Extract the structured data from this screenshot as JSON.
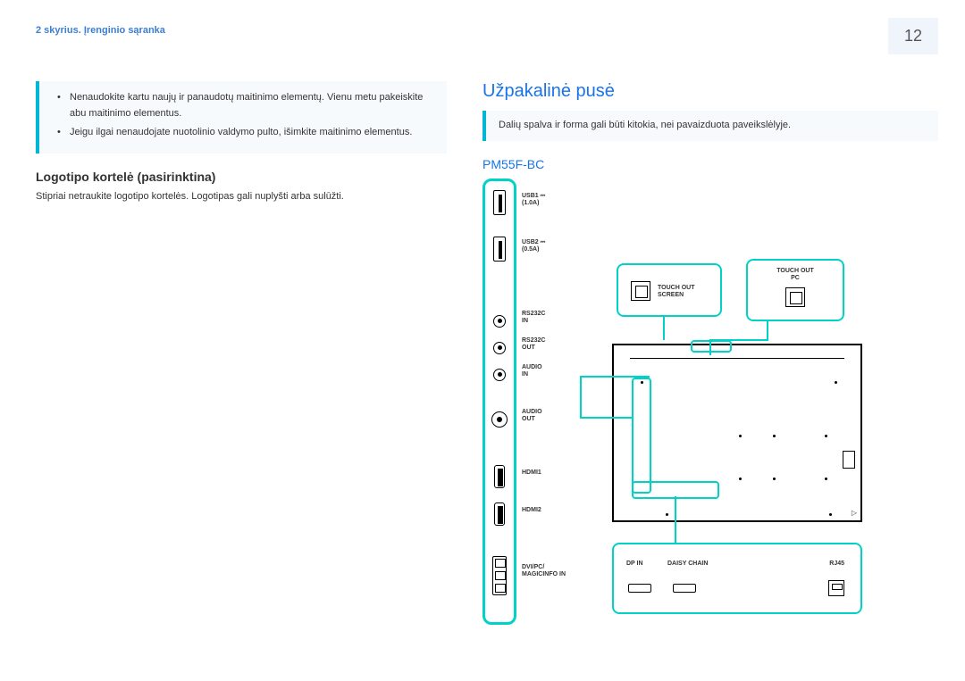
{
  "chapter_label": "2 skyrius. Įrenginio sąranka",
  "page_number": "12",
  "left": {
    "notes": [
      "Nenaudokite kartu naujų ir panaudotų maitinimo elementų. Vienu metu pakeiskite abu maitinimo elementus.",
      "Jeigu ilgai nenaudojate nuotolinio valdymo pulto, išimkite maitinimo elementus."
    ],
    "subheading": "Logotipo kortelė (pasirinktina)",
    "body": "Stipriai netraukite logotipo kortelės. Logotipas gali nuplyšti arba sulūžti."
  },
  "right": {
    "h2": "Užpakalinė pusė",
    "notice": "Dalių spalva ir forma gali būti kitokia, nei pavaizduota paveikslėlyje.",
    "h3": "PM55F-BC",
    "ports": {
      "usb1": "USB1 ⎓\n(1.0A)",
      "usb2": "USB2 ⎓\n(0.5A)",
      "rs232c_in": "RS232C\nIN",
      "rs232c_out": "RS232C\nOUT",
      "audio_in": "AUDIO\nIN",
      "audio_out": "AUDIO\nOUT",
      "hdmi1": "HDMI1",
      "hdmi2": "HDMI2",
      "dvi": "DVI/PC/\nMAGICINFO IN"
    },
    "touch_screen": "TOUCH OUT\nSCREEN",
    "touch_pc": "TOUCH OUT\nPC",
    "bottom": {
      "dp_in": "DP IN",
      "daisy": "DAISY CHAIN",
      "rj45": "RJ45"
    }
  }
}
